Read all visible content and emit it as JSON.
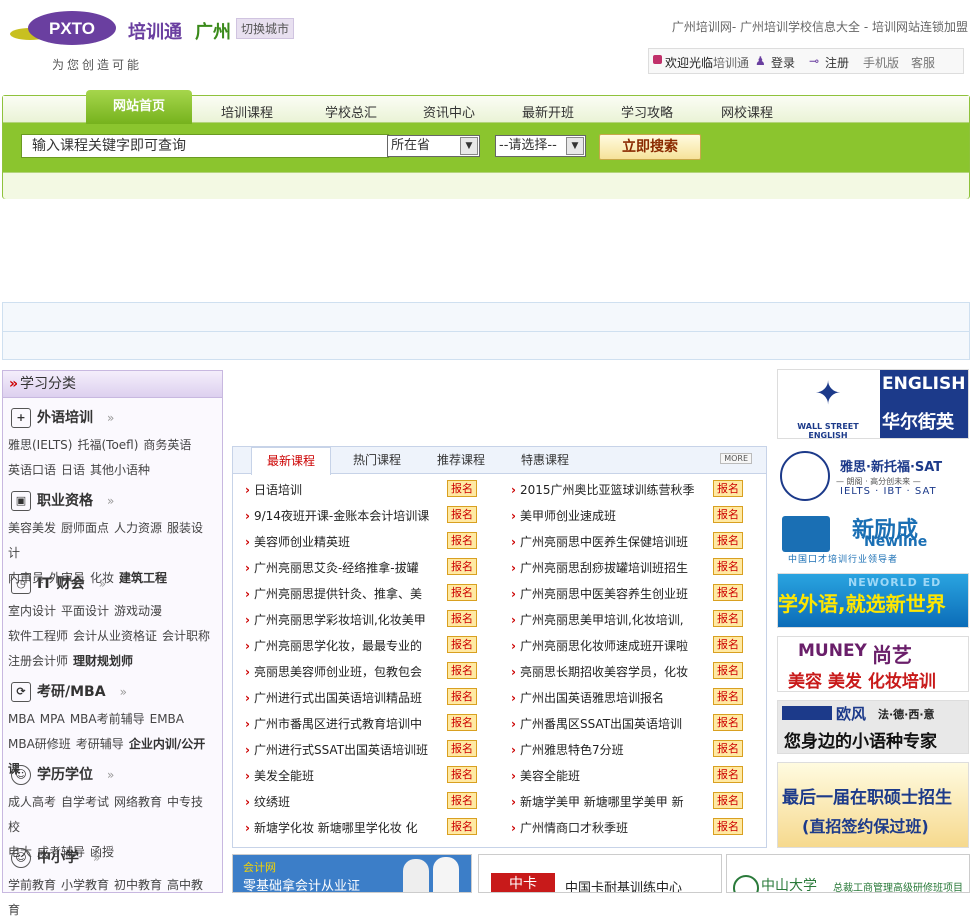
{
  "header": {
    "logo_text": "PXTO",
    "brand": "培训通",
    "city": "广州",
    "switch_city": "切换城市",
    "slogan": "为您创造可能",
    "site_title": "广州培训网- 广州培训学校信息大全 - 培训网站连锁加盟",
    "welcome": "欢迎光临",
    "welcome_site": "培训通",
    "login": "登录",
    "register": "注册",
    "mobile": "手机版",
    "service": "客服"
  },
  "nav": {
    "home": "网站首页",
    "tabs": [
      "培训课程",
      "学校总汇",
      "资讯中心",
      "最新开班",
      "学习攻略",
      "网校课程"
    ]
  },
  "search": {
    "placeholder": "输入课程关键字即可查询",
    "province": "所在省",
    "select": "--请选择--",
    "button": "立即搜索"
  },
  "sidebar": {
    "title": "学习分类",
    "categories": [
      {
        "name": "外语培训",
        "more": "»",
        "rows": [
          [
            "雅思(IELTS)",
            "托福(Toefl)",
            "商务英语"
          ],
          [
            "英语口语",
            "日语",
            "其他小语种"
          ]
        ]
      },
      {
        "name": "职业资格",
        "more": "»",
        "rows": [
          [
            "美容美发",
            "厨师面点",
            "人力资源",
            "服装设计"
          ],
          [
            "内审员",
            "外审员",
            "化妆"
          ]
        ],
        "bold": "建筑工程"
      },
      {
        "name": "IT 财会",
        "more": "»",
        "rows": [
          [
            "室内设计",
            "平面设计",
            "游戏动漫"
          ],
          [
            "软件工程师",
            "会计从业资格证",
            "会计职称"
          ],
          [
            "注册会计师"
          ]
        ],
        "bold": "理财规划师"
      },
      {
        "name": "考研/MBA",
        "more": "»",
        "rows": [
          [
            "MBA",
            "MPA",
            "MBA考前辅导",
            "EMBA"
          ],
          [
            "MBA研修班",
            "考研辅导"
          ]
        ],
        "bold": "企业内训/公开课"
      },
      {
        "name": "学历学位",
        "more": "»",
        "rows": [
          [
            "成人高考",
            "自学考试",
            "网络教育",
            "中专技校"
          ],
          [
            "电大",
            "成考辅导",
            "函授"
          ]
        ]
      },
      {
        "name": "中小学",
        "more": "»",
        "rows": [
          [
            "学前教育",
            "小学教育",
            "初中教育",
            "高中教育"
          ]
        ]
      }
    ]
  },
  "courses": {
    "tabs": [
      "最新课程",
      "热门课程",
      "推荐课程",
      "特惠课程"
    ],
    "more": "MORE",
    "enroll": "报名",
    "left": [
      "日语培训",
      "9/14夜班开课-金账本会计培训课",
      "美容师创业精英班",
      "广州亮丽思艾灸-经络推拿-拔罐",
      "广州亮丽思提供针灸、推拿、美",
      "广州亮丽思学彩妆培训,化妆美甲",
      "广州亮丽思学化妆，最最专业的",
      "亮丽思美容师创业班，包教包会",
      "广州进行式出国英语培训精品班",
      "广州市番禺区进行式教育培训中",
      "广州进行式SSAT出国英语培训班",
      "美发全能班",
      "纹绣班",
      "新塘学化妆 新塘哪里学化妆 化"
    ],
    "right": [
      "2015广州奥比亚篮球训练营秋季",
      "美甲师创业速成班",
      "广州亮丽思中医养生保健培训班",
      "广州亮丽思刮痧拔罐培训班招生",
      "广州亮丽思中医美容养生创业班",
      "广州亮丽思美甲培训,化妆培训,",
      "广州亮丽思化妆师速成班开课啦",
      "亮丽思长期招收美容学员，化妆",
      "广州出国英语雅思培训报名",
      "广州番禺区SSAT出国英语培训",
      "广州雅思特色7分班",
      "美容全能班",
      "新塘学美甲 新塘哪里学美甲 新",
      "广州情商口才秋季班"
    ]
  },
  "ads": {
    "wall_street": [
      "WALL STREET ENGLISH",
      "ENGLISH",
      "华尔街英语"
    ],
    "ielts": [
      "雅思·新托福·SAT",
      "— 朗阁 · 高分创未来 —",
      "IELTS · IBT · SAT"
    ],
    "newline": [
      "新励成",
      "Newline",
      "中国口才培训行业领导者"
    ],
    "new_world": [
      "NEWORLD ED",
      "学外语,就选新世界"
    ],
    "muney": [
      "MUNEY",
      "尚艺",
      "美容 美发 化妆培训"
    ],
    "ouyun": [
      "欧风",
      "法·德·西·意",
      "您身边的小语种专家"
    ],
    "master": [
      "最后一届在职硕士招生",
      "(直招签约保过班)"
    ]
  },
  "bottom_ads": {
    "a": [
      "会计网",
      "零基础拿会计从业证"
    ],
    "b": [
      "中卡",
      "中国卡耐基训练中心"
    ],
    "c": [
      "中山大学",
      "总裁工商管理高级研修班项目"
    ]
  }
}
